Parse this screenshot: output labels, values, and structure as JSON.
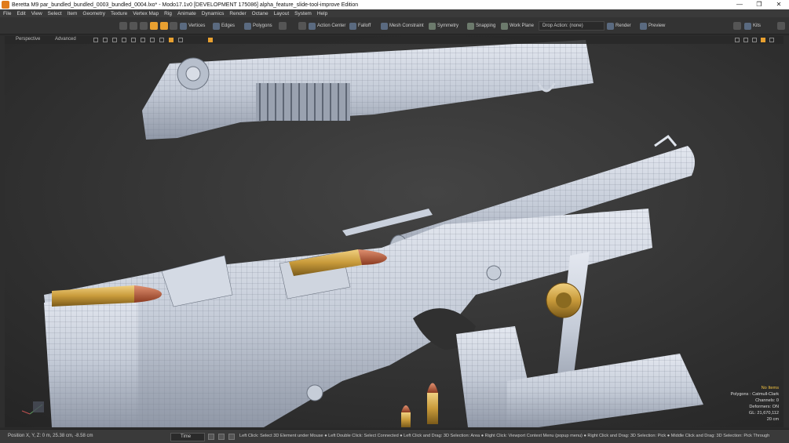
{
  "window": {
    "title": "Beretta M9 par_bundled_bundled_0003_bundled_0004.lxo* - Modo17.1v0 [DEVELOPMENT 175086]  alpha_feature_slide-tool-improve Edition",
    "minimize": "—",
    "maximize": "❐",
    "close": "✕"
  },
  "menu": [
    "File",
    "Edit",
    "View",
    "Select",
    "Item",
    "Geometry",
    "Texture",
    "Vertex Map",
    "Rig",
    "Animate",
    "Dynamics",
    "Render",
    "Octane",
    "Layout",
    "System",
    "Help"
  ],
  "toolbar": {
    "vertices": "Vertices",
    "edges": "Edges",
    "polygons": "Polygons",
    "action_center": "Action Center",
    "falloff": "Falloff",
    "mesh_constraint": "Mesh Constraint",
    "symmetry": "Symmetry",
    "snapping": "Snapping",
    "work_plane": "Work Plane",
    "drop_action": "Drop Action: (none)",
    "render": "Render",
    "preview": "Preview",
    "kits": "Kits"
  },
  "viewport": {
    "view_label": "Perspective",
    "mode_label": "Advanced",
    "stats": {
      "items": "No Items",
      "polygons": "Polygons : Catmull-Clark",
      "channels": "Channels: 0",
      "deformers": "Deformers: ON",
      "gl": "GL: 21,670,112",
      "scale": "20 cm"
    }
  },
  "status": {
    "position": "Position X, Y, Z:  0 m, 25.38 cm, -8.58 cm",
    "time_label": "Time",
    "hint": "Left Click: Select 3D Element under Mouse ● Left Double Click: Select Connected ● Left Click and Drag: 3D Selection: Area ● Right Click: Viewport Context Menu (popup menu) ● Right Click and Drag: 3D Selection: Pick ● Middle Click and Drag: 3D Selection: Pick Through"
  },
  "colors": {
    "accent": "#e8a030",
    "mesh": "#c9d0dc",
    "brass": "#c89a3a"
  }
}
